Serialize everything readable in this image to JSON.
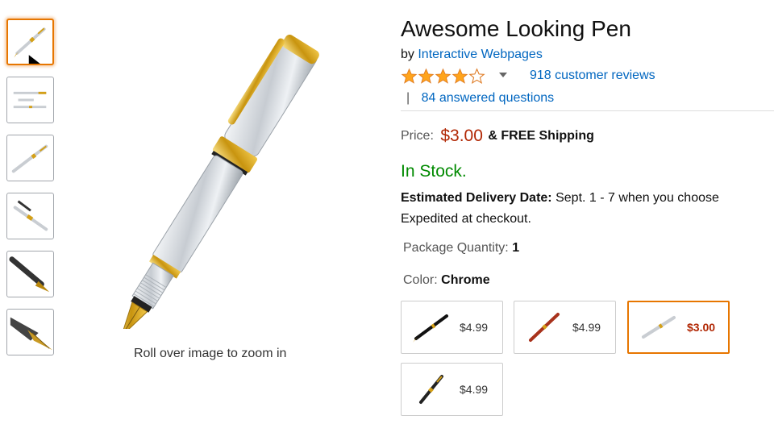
{
  "product": {
    "title": "Awesome Looking Pen",
    "by_prefix": "by",
    "brand": "Interactive Webpages",
    "rating": 4,
    "rating_max": 5,
    "reviews": "918 customer reviews",
    "qa_separator": "|",
    "answered": "84 answered questions"
  },
  "price": {
    "label": "Price:",
    "value": "$3.00",
    "shipping": "& FREE Shipping"
  },
  "availability": {
    "status": "In Stock.",
    "delivery_label": "Estimated Delivery Date:",
    "delivery_text": "Sept. 1 - 7 when you choose Expedited at checkout."
  },
  "options": {
    "package_label": "Package Quantity:",
    "package_value": "1",
    "color_label": "Color:",
    "color_value": "Chrome"
  },
  "swatches": [
    {
      "price": "$4.99",
      "icon": "black-pen-icon"
    },
    {
      "price": "$4.99",
      "icon": "red-pen-icon"
    },
    {
      "price": "$3.00",
      "icon": "chrome-pen-icon",
      "selected": true
    },
    {
      "price": "$4.99",
      "icon": "gold-black-pen-icon"
    }
  ],
  "image": {
    "zoom_hint": "Roll over image to zoom in",
    "thumbnail_count": 6,
    "selected_thumbnail": 1
  },
  "colors": {
    "link": "#0066c0",
    "price": "#b12704",
    "stock": "#008a00",
    "star": "#ffa41c",
    "selected_border": "#e77600"
  }
}
